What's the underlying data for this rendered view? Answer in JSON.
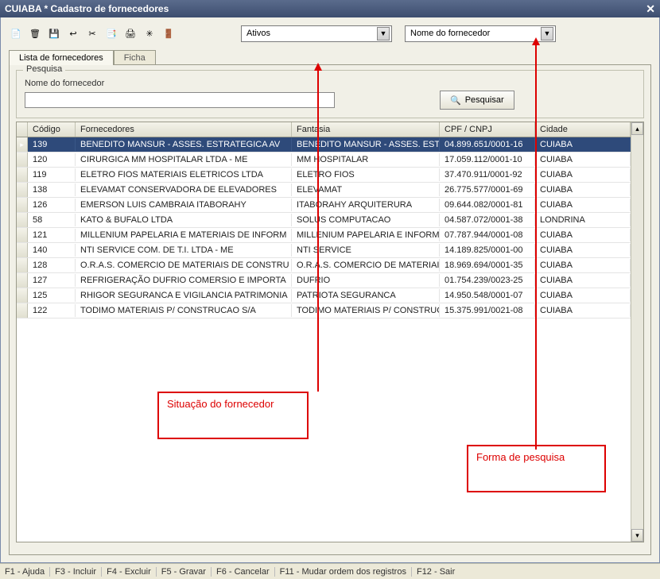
{
  "window": {
    "title": "CUIABA * Cadastro de fornecedores",
    "close_glyph": "✕"
  },
  "toolbar": {
    "icons": {
      "new": "📄",
      "delete": "🗑",
      "save": "💾",
      "undo": "↩",
      "cut": "✂",
      "copy": "📑",
      "print": "🖨",
      "export": "✳",
      "exit": "🚪"
    },
    "filter_status": {
      "value": "Ativos"
    },
    "filter_sort": {
      "value": "Nome do fornecedor"
    }
  },
  "tabs": {
    "list": "Lista de fornecedores",
    "form": "Ficha"
  },
  "search": {
    "group_label": "Pesquisa",
    "field_label": "Nome do fornecedor",
    "value": "",
    "button": "Pesquisar"
  },
  "grid": {
    "columns": {
      "codigo": "Código",
      "fornecedores": "Fornecedores",
      "fantasia": "Fantasia",
      "cpfcnpj": "CPF / CNPJ",
      "cidade": "Cidade"
    },
    "rows": [
      {
        "codigo": "139",
        "fornecedor": "BENEDITO MANSUR - ASSES. ESTRATEGICA AV",
        "fantasia": "BENEDITO MANSUR - ASSES. ESTRATEG",
        "cpfcnpj": "04.899.651/0001-16",
        "cidade": "CUIABA",
        "selected": true
      },
      {
        "codigo": "120",
        "fornecedor": "CIRURGICA MM HOSPITALAR LTDA - ME",
        "fantasia": "MM HOSPITALAR",
        "cpfcnpj": "17.059.112/0001-10",
        "cidade": "CUIABA"
      },
      {
        "codigo": "119",
        "fornecedor": "ELETRO FIOS MATERIAIS ELETRICOS LTDA",
        "fantasia": "ELETRO FIOS",
        "cpfcnpj": "37.470.911/0001-92",
        "cidade": "CUIABA"
      },
      {
        "codigo": "138",
        "fornecedor": "ELEVAMAT CONSERVADORA DE ELEVADORES",
        "fantasia": "ELEVAMAT",
        "cpfcnpj": "26.775.577/0001-69",
        "cidade": "CUIABA"
      },
      {
        "codigo": "126",
        "fornecedor": "EMERSON LUIS CAMBRAIA ITABORAHY",
        "fantasia": "ITABORAHY ARQUITERURA",
        "cpfcnpj": "09.644.082/0001-81",
        "cidade": "CUIABA"
      },
      {
        "codigo": "58",
        "fornecedor": "KATO & BUFALO LTDA",
        "fantasia": "SOLUS COMPUTACAO",
        "cpfcnpj": "04.587.072/0001-38",
        "cidade": "LONDRINA"
      },
      {
        "codigo": "121",
        "fornecedor": "MILLENIUM PAPELARIA E MATERIAIS DE INFORM",
        "fantasia": "MILLENIUM PAPELARIA E INFORMATICA",
        "cpfcnpj": "07.787.944/0001-08",
        "cidade": "CUIABA"
      },
      {
        "codigo": "140",
        "fornecedor": "NTI SERVICE COM. DE T.I. LTDA - ME",
        "fantasia": "NTI SERVICE",
        "cpfcnpj": "14.189.825/0001-00",
        "cidade": "CUIABA"
      },
      {
        "codigo": "128",
        "fornecedor": "O.R.A.S. COMERCIO DE MATERIAIS DE CONSTRU",
        "fantasia": "O.R.A.S. COMERCIO DE MATERIAIS DE C",
        "cpfcnpj": "18.969.694/0001-35",
        "cidade": "CUIABA"
      },
      {
        "codigo": "127",
        "fornecedor": "REFRIGERAÇÃO  DUFRIO COMERSIO E IMPORTA",
        "fantasia": "DUFRIO",
        "cpfcnpj": "01.754.239/0023-25",
        "cidade": "CUIABA"
      },
      {
        "codigo": "125",
        "fornecedor": "RHIGOR SEGURANCA E VIGILANCIA PATRIMONIA",
        "fantasia": "PATRIOTA SEGURANCA",
        "cpfcnpj": "14.950.548/0001-07",
        "cidade": "CUIABA"
      },
      {
        "codigo": "122",
        "fornecedor": "TODIMO MATERIAIS P/ CONSTRUCAO S/A",
        "fantasia": "TODIMO MATERIAIS P/ CONSTRUCAO",
        "cpfcnpj": "15.375.991/0021-08",
        "cidade": "CUIABA"
      }
    ]
  },
  "annotations": {
    "status_label": "Situação do fornecedor",
    "sort_label": "Forma de pesquisa"
  },
  "statusbar": {
    "items": [
      "F1 - Ajuda",
      "F3 - Incluir",
      "F4 - Excluir",
      "F5 - Gravar",
      "F6 - Cancelar",
      "F11 - Mudar ordem dos registros",
      "F12 - Sair"
    ]
  }
}
